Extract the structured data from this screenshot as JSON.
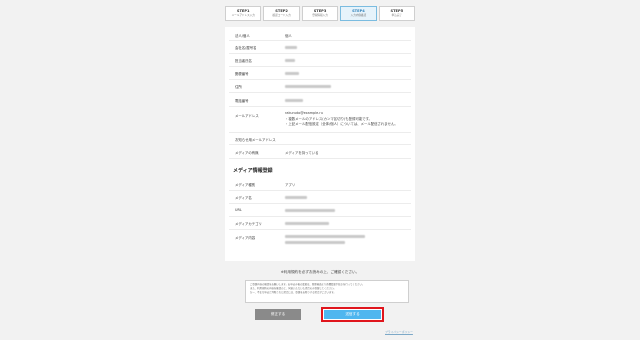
{
  "stepper": [
    {
      "num": "STEP1",
      "sub": "メールアドレス入力"
    },
    {
      "num": "STEP2",
      "sub": "確認コード入力"
    },
    {
      "num": "STEP3",
      "sub": "登録情報入力"
    },
    {
      "num": "STEP4",
      "sub": "入力内容確認",
      "active": true
    },
    {
      "num": "STEP5",
      "sub": "申込完了"
    }
  ],
  "form": {
    "rows": [
      {
        "label": "法人/個人",
        "value": "個人"
      },
      {
        "label": "会社名/屋号名",
        "value": ""
      },
      {
        "label": "担当者氏名",
        "value": ""
      },
      {
        "label": "郵便番号",
        "value": ""
      },
      {
        "label": "住所",
        "value": ""
      },
      {
        "label": "電話番号",
        "value": ""
      },
      {
        "label": "メールアドレス",
        "value": "rakurudo@example.ru"
      },
      {
        "label": "お知らせ用メールアドレス",
        "value": ""
      },
      {
        "label": "メディアの有無",
        "value": "メディアを持っている"
      }
    ],
    "email_note_1": "・複数メールのアドレス(カンマ区切り)も登録可能です。",
    "email_note_2": "・上記メール配信設定（全体/個人）については、メール配信されません。",
    "section_title": "メディア情報登録",
    "media_rows": [
      {
        "label": "メディア種別",
        "value": "アプリ"
      },
      {
        "label": "メディア名",
        "value": ""
      },
      {
        "label": "URL",
        "value": ""
      },
      {
        "label": "メディアカテゴリ",
        "value": ""
      },
      {
        "label": "メディア内容",
        "value": ""
      }
    ]
  },
  "confirm": {
    "text": "※利用規約を必ずお読みの上、ご確認ください。",
    "terms_line_1": "ご登録内容の確認をお願いします。お申込み後の変更は、管理画面より各種変更手続きを行ってください。",
    "terms_line_2": "また、利用規約の内容を確認の上、同意いただいた場合のみ登録してください。",
    "terms_line_3": "万一、不正な申込と判断された場合には、登録をお断りする場合がございます。",
    "back_label": "修正する",
    "send_label": "送信する",
    "footer_link": "プライバシーポリシー"
  },
  "colors": {
    "accent": "#4fb6ef",
    "highlight": "#e0161d",
    "active_step": "#e6f3fb"
  }
}
